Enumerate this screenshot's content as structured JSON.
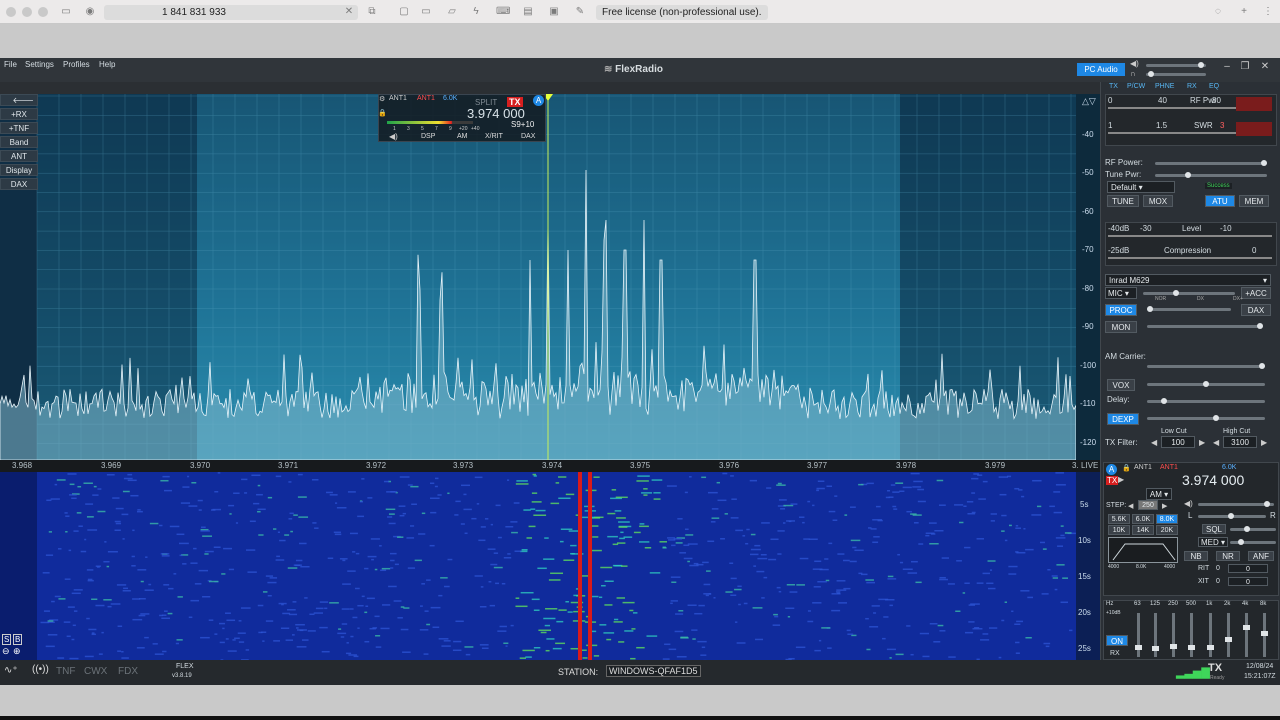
{
  "browser": {
    "address": "1 841 831 933",
    "license": "Free license (non-professional use)."
  },
  "app": {
    "menu": [
      "File",
      "Settings",
      "Profiles",
      "Help"
    ],
    "brand": "FlexRadio",
    "pc_audio": "PC Audio"
  },
  "left_tabs": [
    "+RX",
    "+TNF",
    "Band",
    "ANT",
    "Display",
    "DAX"
  ],
  "slice": {
    "ant1": "ANT1",
    "ant2": "ANT1",
    "bw": "6.0K",
    "split": "SPLIT",
    "tx": "TX",
    "letter": "A",
    "freq": "3.974 000",
    "signal": "S9+10",
    "scale": [
      "1",
      "3",
      "5",
      "7",
      "9",
      "+20",
      "+40"
    ],
    "buttons": [
      "DSP",
      "AM",
      "X/RIT",
      "DAX"
    ]
  },
  "dbm_scale": [
    "-40",
    "-50",
    "-60",
    "-70",
    "-80",
    "-90",
    "-100",
    "-110",
    "-120"
  ],
  "freq_axis": [
    "3.968",
    "3.969",
    "3.970",
    "3.971",
    "3.972",
    "3.973",
    "3.974",
    "3.975",
    "3.976",
    "3.977",
    "3.978",
    "3.979",
    "3."
  ],
  "live": "LIVE",
  "time_scale": [
    "5s",
    "10s",
    "15s",
    "20s",
    "25s"
  ],
  "panel": {
    "tabs": [
      "TX",
      "P/CW",
      "PHNE",
      "RX",
      "EQ"
    ],
    "meter1": {
      "a": "0",
      "b": "40",
      "label": "RF Pwr",
      "c": "80"
    },
    "meter2": {
      "a": "1",
      "b": "1.5",
      "label": "SWR",
      "c": "3"
    },
    "rf_power": "RF Power:",
    "tune_pwr": "Tune Pwr:",
    "profile": "Default",
    "success": "Success",
    "btn_tune": "TUNE",
    "btn_mox": "MOX",
    "btn_atu": "ATU",
    "btn_mem": "MEM",
    "meter3": {
      "a": "-40dB",
      "b": "-30",
      "label": "Level",
      "c": "-10"
    },
    "meter4": {
      "a": "-25dB",
      "label": "Compression",
      "c": "0"
    },
    "mic_profile": "Inrad M629",
    "mic": "MIC",
    "acc": "+ACC",
    "proc": "PROC",
    "nor": "NOR",
    "dx": "DX",
    "dxplus": "DX+",
    "dax": "DAX",
    "mon": "MON",
    "am_carrier": "AM Carrier:",
    "vox": "VOX",
    "delay": "Delay:",
    "dexp": "DEXP",
    "low_cut": "Low Cut",
    "high_cut": "High Cut",
    "tx_filter": "TX Filter:",
    "low_val": "100",
    "high_val": "3100"
  },
  "slice_panel": {
    "letter": "A",
    "tx": "TX",
    "ant1": "ANT1",
    "ant2": "ANT1",
    "bw": "6.0K",
    "freq": "3.974 000",
    "mode": "AM",
    "step_label": "STEP:",
    "step": "250",
    "filters": [
      "5.6K",
      "6.0K",
      "8.0K",
      "10K",
      "14K",
      "20K"
    ],
    "shape": [
      "4000",
      "8.0K",
      "4000"
    ],
    "sql": "SQL",
    "agc": "MED",
    "nb": "NB",
    "nr": "NR",
    "anf": "ANF",
    "rit": "RIT",
    "rit_val": "0",
    "xit": "XIT",
    "xit_val": "0",
    "l": "L",
    "r": "R"
  },
  "eq": {
    "bands": [
      "Hz",
      "63",
      "125",
      "250",
      "500",
      "1k",
      "2k",
      "4k",
      "8k"
    ],
    "db": "+10dB",
    "on": "ON",
    "rx": "RX"
  },
  "status": {
    "modes": [
      "TNF",
      "CWX",
      "FDX"
    ],
    "flex": "FLEX",
    "version": "v3.8.19",
    "station_label": "STATION:",
    "station": "WINDOWS-QFAF1D5",
    "tx": "TX",
    "ready": "Ready",
    "date": "12/08/24",
    "time": "15:21:07Z"
  }
}
